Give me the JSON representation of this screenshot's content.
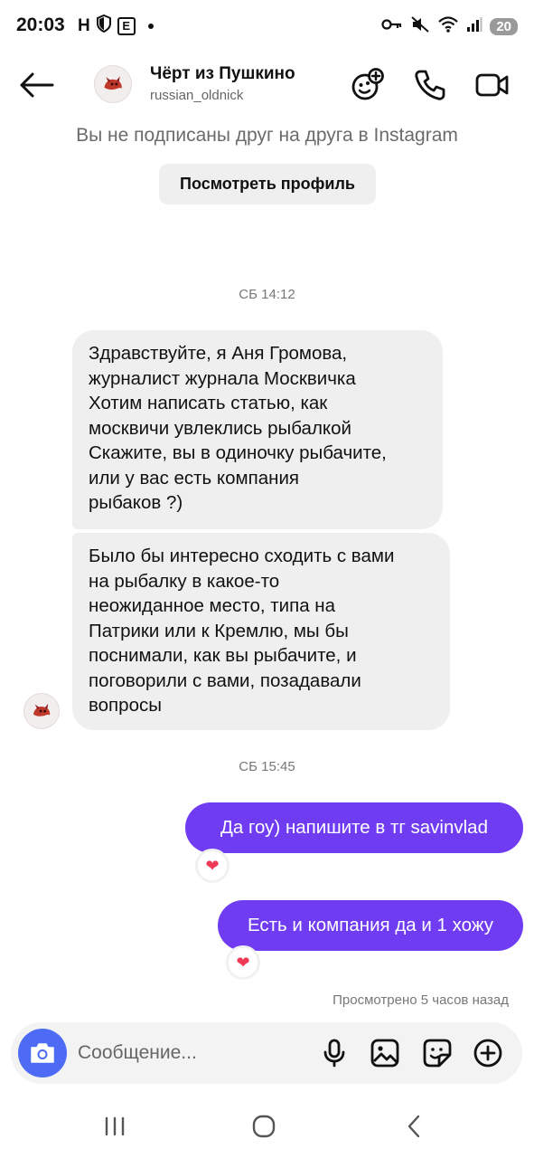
{
  "status_bar": {
    "time": "20:03",
    "left_icons": [
      "H",
      "shield-icon",
      "E"
    ],
    "battery": "20",
    "right_icons": [
      "key-icon",
      "mute-icon",
      "wifi-icon",
      "signal-icon"
    ]
  },
  "header": {
    "contact_name": "Чёрт из Пушкино",
    "username": "russian_oldnick",
    "icons": [
      "back-arrow-icon",
      "effects-icon",
      "phone-icon",
      "video-icon"
    ]
  },
  "follow_notice": "Вы не подписаны друг на друга в Instagram",
  "view_profile_button": "Посмотреть профиль",
  "timestamps": [
    "СБ 14:12",
    "СБ 15:45"
  ],
  "incoming_messages": [
    {
      "lines": [
        "Здравствуйте, я Аня Громова,",
        "журналист журнала Москвичка",
        "Хотим написать статью, как",
        "москвичи увлеклись рыбалкой",
        "Скажите, вы в одиночку рыбачите,",
        "или у вас есть компания",
        "рыбаков ?)"
      ]
    },
    {
      "lines": [
        "Было бы интересно сходить с вами",
        "на рыбалку в какое-то",
        "неожиданное место, типа на",
        "Патрики или к Кремлю, мы бы",
        "поснимали, как вы рыбачите, и",
        "поговорили с вами, позадавали",
        "вопросы"
      ]
    }
  ],
  "outgoing_messages": [
    {
      "text": "Да гоу) напишите в тг savinvlad",
      "reaction": "❤"
    },
    {
      "text": "Есть и компания да и 1 хожу",
      "reaction": "❤"
    }
  ],
  "seen_status": "Просмотрено 5 часов назад",
  "composer": {
    "placeholder": "Сообщение...",
    "icons": [
      "camera-icon",
      "mic-icon",
      "gallery-icon",
      "sticker-icon",
      "plus-icon"
    ]
  },
  "colors": {
    "outgoing_bubble": "#6f3cf2",
    "incoming_bubble": "#efefef",
    "camera_button": "#4d6bf5",
    "reaction_heart": "#ef3a57"
  }
}
